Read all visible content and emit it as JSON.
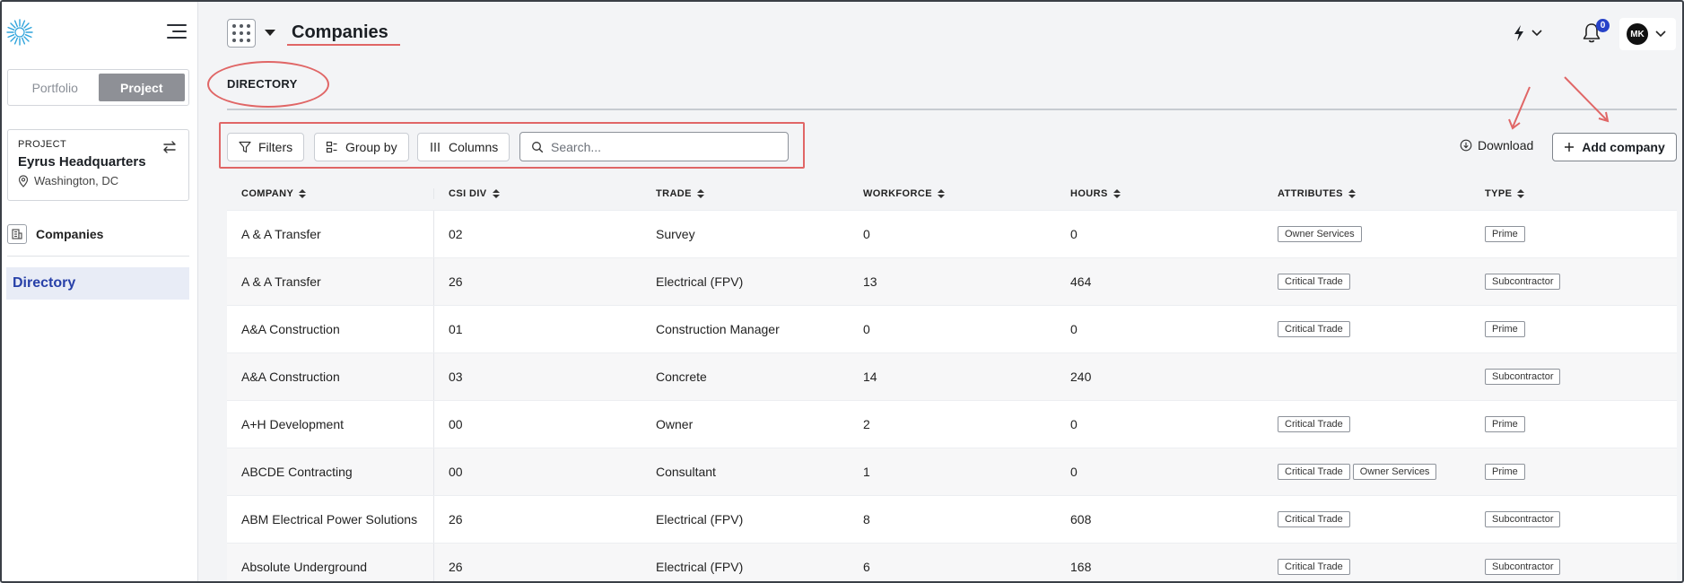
{
  "sidebar": {
    "toggle": {
      "portfolio": "Portfolio",
      "project": "Project"
    },
    "project_card": {
      "label": "PROJECT",
      "name": "Eyrus Headquarters",
      "location": "Washington, DC"
    },
    "nav": {
      "companies": "Companies",
      "directory": "Directory"
    }
  },
  "header": {
    "title": "Companies",
    "notification_count": "0",
    "user_initials": "MK"
  },
  "tabs": {
    "directory": "DIRECTORY"
  },
  "toolbar": {
    "filters": "Filters",
    "group_by": "Group by",
    "columns": "Columns",
    "search_placeholder": "Search...",
    "download": "Download",
    "add_company": "Add company"
  },
  "table": {
    "columns": [
      "COMPANY",
      "CSI DIV",
      "TRADE",
      "WORKFORCE",
      "HOURS",
      "ATTRIBUTES",
      "TYPE"
    ],
    "rows": [
      {
        "company": "A & A Transfer",
        "csi": "02",
        "trade": "Survey",
        "workforce": "0",
        "hours": "0",
        "attributes": [
          "Owner Services"
        ],
        "type": "Prime"
      },
      {
        "company": "A & A Transfer",
        "csi": "26",
        "trade": "Electrical (FPV)",
        "workforce": "13",
        "hours": "464",
        "attributes": [
          "Critical Trade"
        ],
        "type": "Subcontractor"
      },
      {
        "company": "A&A Construction",
        "csi": "01",
        "trade": "Construction Manager",
        "workforce": "0",
        "hours": "0",
        "attributes": [
          "Critical Trade"
        ],
        "type": "Prime"
      },
      {
        "company": "A&A Construction",
        "csi": "03",
        "trade": "Concrete",
        "workforce": "14",
        "hours": "240",
        "attributes": [],
        "type": "Subcontractor"
      },
      {
        "company": "A+H Development",
        "csi": "00",
        "trade": "Owner",
        "workforce": "2",
        "hours": "0",
        "attributes": [
          "Critical Trade"
        ],
        "type": "Prime"
      },
      {
        "company": "ABCDE Contracting",
        "csi": "00",
        "trade": "Consultant",
        "workforce": "1",
        "hours": "0",
        "attributes": [
          "Critical Trade",
          "Owner Services"
        ],
        "type": "Prime"
      },
      {
        "company": "ABM Electrical Power Solutions",
        "csi": "26",
        "trade": "Electrical (FPV)",
        "workforce": "8",
        "hours": "608",
        "attributes": [
          "Critical Trade"
        ],
        "type": "Subcontractor"
      },
      {
        "company": "Absolute Underground",
        "csi": "26",
        "trade": "Electrical (FPV)",
        "workforce": "6",
        "hours": "168",
        "attributes": [
          "Critical Trade"
        ],
        "type": "Subcontractor"
      }
    ]
  },
  "colors": {
    "annotation": "#e06666",
    "active_nav_text": "#2740a8",
    "active_nav_bg": "#e8ecf6",
    "badge": "#2742c8",
    "logo": "#2fa4dc"
  }
}
